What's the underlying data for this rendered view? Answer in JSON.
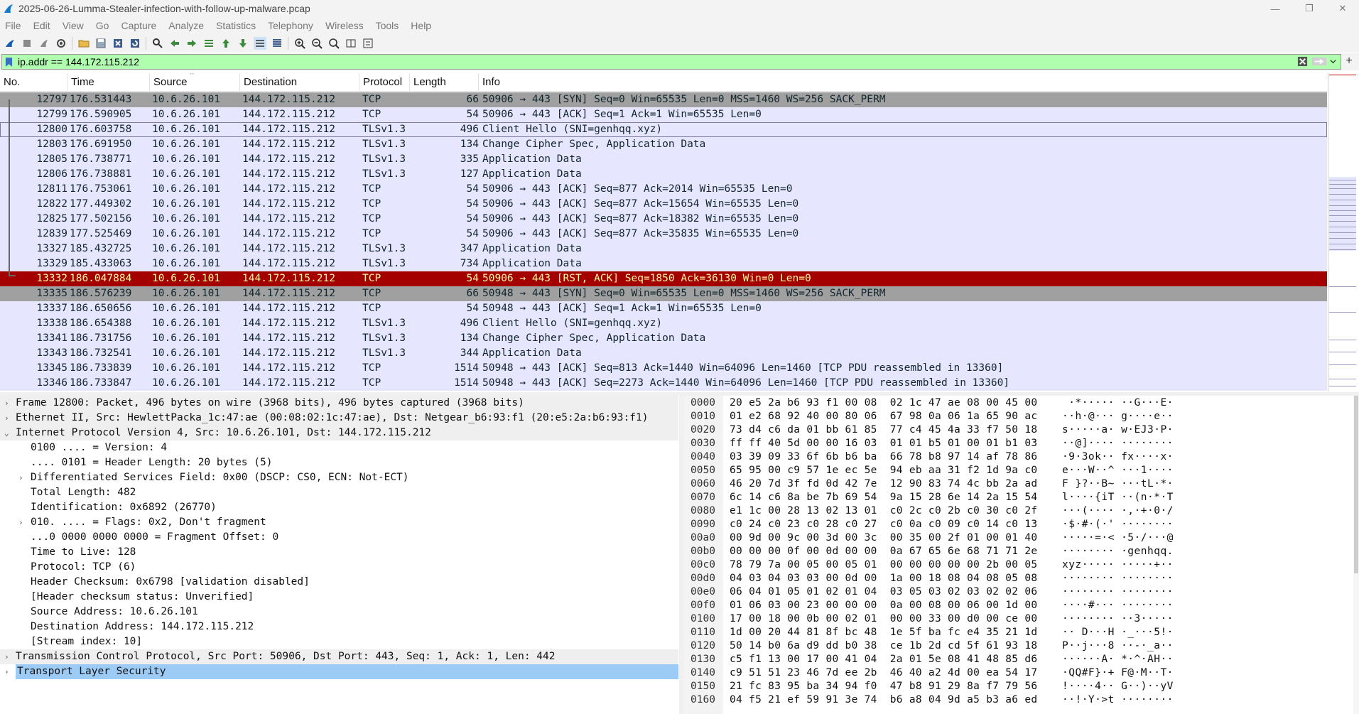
{
  "window": {
    "title": "2025-06-26-Lumma-Stealer-infection-with-follow-up-malware.pcap",
    "controls": [
      "—",
      "❐",
      "✕"
    ]
  },
  "menu": [
    "File",
    "Edit",
    "View",
    "Go",
    "Capture",
    "Analyze",
    "Statistics",
    "Telephony",
    "Wireless",
    "Tools",
    "Help"
  ],
  "filter": {
    "value": "ip.addr == 144.172.115.212",
    "add_label": "+"
  },
  "columns": {
    "no": "No.",
    "time": "Time",
    "source": "Source",
    "destination": "Destination",
    "protocol": "Protocol",
    "length": "Length",
    "info": "Info"
  },
  "packets": [
    {
      "no": "12797",
      "time": "176.531443",
      "src": "10.6.26.101",
      "dst": "144.172.115.212",
      "proto": "TCP",
      "len": "66",
      "info": "50906 → 443 [SYN] Seq=0 Win=65535 Len=0 MSS=1460 WS=256 SACK_PERM",
      "style": "gray"
    },
    {
      "no": "12799",
      "time": "176.590905",
      "src": "10.6.26.101",
      "dst": "144.172.115.212",
      "proto": "TCP",
      "len": "54",
      "info": "50906 → 443 [ACK] Seq=1 Ack=1 Win=65535 Len=0",
      "style": "lav"
    },
    {
      "no": "12800",
      "time": "176.603758",
      "src": "10.6.26.101",
      "dst": "144.172.115.212",
      "proto": "TLSv1.3",
      "len": "496",
      "info": "Client Hello (SNI=genhqq.xyz)",
      "style": "lav sel"
    },
    {
      "no": "12803",
      "time": "176.691950",
      "src": "10.6.26.101",
      "dst": "144.172.115.212",
      "proto": "TLSv1.3",
      "len": "134",
      "info": "Change Cipher Spec, Application Data",
      "style": "lav"
    },
    {
      "no": "12805",
      "time": "176.738771",
      "src": "10.6.26.101",
      "dst": "144.172.115.212",
      "proto": "TLSv1.3",
      "len": "335",
      "info": "Application Data",
      "style": "lav"
    },
    {
      "no": "12806",
      "time": "176.738881",
      "src": "10.6.26.101",
      "dst": "144.172.115.212",
      "proto": "TLSv1.3",
      "len": "127",
      "info": "Application Data",
      "style": "lav"
    },
    {
      "no": "12811",
      "time": "176.753061",
      "src": "10.6.26.101",
      "dst": "144.172.115.212",
      "proto": "TCP",
      "len": "54",
      "info": "50906 → 443 [ACK] Seq=877 Ack=2014 Win=65535 Len=0",
      "style": "lav"
    },
    {
      "no": "12822",
      "time": "177.449302",
      "src": "10.6.26.101",
      "dst": "144.172.115.212",
      "proto": "TCP",
      "len": "54",
      "info": "50906 → 443 [ACK] Seq=877 Ack=15654 Win=65535 Len=0",
      "style": "lav"
    },
    {
      "no": "12825",
      "time": "177.502156",
      "src": "10.6.26.101",
      "dst": "144.172.115.212",
      "proto": "TCP",
      "len": "54",
      "info": "50906 → 443 [ACK] Seq=877 Ack=18382 Win=65535 Len=0",
      "style": "lav"
    },
    {
      "no": "12839",
      "time": "177.525469",
      "src": "10.6.26.101",
      "dst": "144.172.115.212",
      "proto": "TCP",
      "len": "54",
      "info": "50906 → 443 [ACK] Seq=877 Ack=35835 Win=65535 Len=0",
      "style": "lav"
    },
    {
      "no": "13327",
      "time": "185.432725",
      "src": "10.6.26.101",
      "dst": "144.172.115.212",
      "proto": "TLSv1.3",
      "len": "347",
      "info": "Application Data",
      "style": "lav"
    },
    {
      "no": "13329",
      "time": "185.433063",
      "src": "10.6.26.101",
      "dst": "144.172.115.212",
      "proto": "TLSv1.3",
      "len": "734",
      "info": "Application Data",
      "style": "lav"
    },
    {
      "no": "13332",
      "time": "186.047884",
      "src": "10.6.26.101",
      "dst": "144.172.115.212",
      "proto": "TCP",
      "len": "54",
      "info": "50906 → 443 [RST, ACK] Seq=1850 Ack=36130 Win=0 Len=0",
      "style": "red"
    },
    {
      "no": "13335",
      "time": "186.576239",
      "src": "10.6.26.101",
      "dst": "144.172.115.212",
      "proto": "TCP",
      "len": "66",
      "info": "50948 → 443 [SYN] Seq=0 Win=65535 Len=0 MSS=1460 WS=256 SACK_PERM",
      "style": "gray"
    },
    {
      "no": "13337",
      "time": "186.650656",
      "src": "10.6.26.101",
      "dst": "144.172.115.212",
      "proto": "TCP",
      "len": "54",
      "info": "50948 → 443 [ACK] Seq=1 Ack=1 Win=65535 Len=0",
      "style": "lav"
    },
    {
      "no": "13338",
      "time": "186.654388",
      "src": "10.6.26.101",
      "dst": "144.172.115.212",
      "proto": "TLSv1.3",
      "len": "496",
      "info": "Client Hello (SNI=genhqq.xyz)",
      "style": "lav"
    },
    {
      "no": "13341",
      "time": "186.731756",
      "src": "10.6.26.101",
      "dst": "144.172.115.212",
      "proto": "TLSv1.3",
      "len": "134",
      "info": "Change Cipher Spec, Application Data",
      "style": "lav"
    },
    {
      "no": "13343",
      "time": "186.732541",
      "src": "10.6.26.101",
      "dst": "144.172.115.212",
      "proto": "TLSv1.3",
      "len": "344",
      "info": "Application Data",
      "style": "lav"
    },
    {
      "no": "13345",
      "time": "186.733839",
      "src": "10.6.26.101",
      "dst": "144.172.115.212",
      "proto": "TCP",
      "len": "1514",
      "info": "50948 → 443 [ACK] Seq=813 Ack=1440 Win=64096 Len=1460 [TCP PDU reassembled in 13360]",
      "style": "lav"
    },
    {
      "no": "13346",
      "time": "186.733847",
      "src": "10.6.26.101",
      "dst": "144.172.115.212",
      "proto": "TCP",
      "len": "1514",
      "info": "50948 → 443 [ACK] Seq=2273 Ack=1440 Win=64096 Len=1460 [TCP PDU reassembled in 13360]",
      "style": "lav"
    }
  ],
  "details": [
    {
      "text": "Frame 12800: Packet, 496 bytes on wire (3968 bits), 496 bytes captured (3968 bits)",
      "level": 0,
      "arrow": "›",
      "top": true
    },
    {
      "text": "Ethernet II, Src: HewlettPacka_1c:47:ae (00:08:02:1c:47:ae), Dst: Netgear_b6:93:f1 (20:e5:2a:b6:93:f1)",
      "level": 0,
      "arrow": "›",
      "top": true
    },
    {
      "text": "Internet Protocol Version 4, Src: 10.6.26.101, Dst: 144.172.115.212",
      "level": 0,
      "arrow": "⌄",
      "top": true
    },
    {
      "text": "0100 .... = Version: 4",
      "level": 1,
      "arrow": ""
    },
    {
      "text": ".... 0101 = Header Length: 20 bytes (5)",
      "level": 1,
      "arrow": ""
    },
    {
      "text": "Differentiated Services Field: 0x00 (DSCP: CS0, ECN: Not-ECT)",
      "level": 1,
      "arrow": "›"
    },
    {
      "text": "Total Length: 482",
      "level": 1,
      "arrow": ""
    },
    {
      "text": "Identification: 0x6892 (26770)",
      "level": 1,
      "arrow": ""
    },
    {
      "text": "010. .... = Flags: 0x2, Don't fragment",
      "level": 1,
      "arrow": "›"
    },
    {
      "text": "...0 0000 0000 0000 = Fragment Offset: 0",
      "level": 1,
      "arrow": ""
    },
    {
      "text": "Time to Live: 128",
      "level": 1,
      "arrow": ""
    },
    {
      "text": "Protocol: TCP (6)",
      "level": 1,
      "arrow": ""
    },
    {
      "text": "Header Checksum: 0x6798 [validation disabled]",
      "level": 1,
      "arrow": ""
    },
    {
      "text": "[Header checksum status: Unverified]",
      "level": 1,
      "arrow": ""
    },
    {
      "text": "Source Address: 10.6.26.101",
      "level": 1,
      "arrow": ""
    },
    {
      "text": "Destination Address: 144.172.115.212",
      "level": 1,
      "arrow": ""
    },
    {
      "text": "[Stream index: 10]",
      "level": 1,
      "arrow": ""
    },
    {
      "text": "Transmission Control Protocol, Src Port: 50906, Dst Port: 443, Seq: 1, Ack: 1, Len: 442",
      "level": 0,
      "arrow": "›",
      "top": true
    },
    {
      "text": "Transport Layer Security",
      "level": 0,
      "arrow": "›",
      "top": true,
      "selected": true
    }
  ],
  "hex": [
    {
      "off": "0000",
      "bytes": "20 e5 2a b6 93 f1 00 08  02 1c 47 ae 08 00 45 00",
      "ascii": " ·*····· ··G···E·"
    },
    {
      "off": "0010",
      "bytes": "01 e2 68 92 40 00 80 06  67 98 0a 06 1a 65 90 ac",
      "ascii": "··h·@··· g····e··"
    },
    {
      "off": "0020",
      "bytes": "73 d4 c6 da 01 bb 61 85  77 c4 45 4a 33 f7 50 18",
      "ascii": "s·····a· w·EJ3·P·"
    },
    {
      "off": "0030",
      "bytes": "ff ff 40 5d 00 00 16 03  01 01 b5 01 00 01 b1 03",
      "ascii": "··@]···· ········"
    },
    {
      "off": "0040",
      "bytes": "03 39 09 33 6f 6b b6 ba  66 78 b8 97 14 af 78 86",
      "ascii": "·9·3ok·· fx····x·"
    },
    {
      "off": "0050",
      "bytes": "65 95 00 c9 57 1e ec 5e  94 eb aa 31 f2 1d 9a c0",
      "ascii": "e···W··^ ···1····"
    },
    {
      "off": "0060",
      "bytes": "46 20 7d 3f fd 0d 42 7e  12 90 83 74 4c bb 2a ad",
      "ascii": "F }?··B~ ···tL·*·"
    },
    {
      "off": "0070",
      "bytes": "6c 14 c6 8a be 7b 69 54  9a 15 28 6e 14 2a 15 54",
      "ascii": "l····{iT ··(n·*·T"
    },
    {
      "off": "0080",
      "bytes": "e1 1c 00 28 13 02 13 01  c0 2c c0 2b c0 30 c0 2f",
      "ascii": "···(···· ·,·+·0·/"
    },
    {
      "off": "0090",
      "bytes": "c0 24 c0 23 c0 28 c0 27  c0 0a c0 09 c0 14 c0 13",
      "ascii": "·$·#·(·' ········"
    },
    {
      "off": "00a0",
      "bytes": "00 9d 00 9c 00 3d 00 3c  00 35 00 2f 01 00 01 40",
      "ascii": "·····=·< ·5·/···@"
    },
    {
      "off": "00b0",
      "bytes": "00 00 00 0f 00 0d 00 00  0a 67 65 6e 68 71 71 2e",
      "ascii": "········ ·genhqq."
    },
    {
      "off": "00c0",
      "bytes": "78 79 7a 00 05 00 05 01  00 00 00 00 00 2b 00 05",
      "ascii": "xyz····· ·····+··"
    },
    {
      "off": "00d0",
      "bytes": "04 03 04 03 03 00 0d 00  1a 00 18 08 04 08 05 08",
      "ascii": "········ ········"
    },
    {
      "off": "00e0",
      "bytes": "06 04 01 05 01 02 01 04  03 05 03 02 03 02 02 06",
      "ascii": "········ ········"
    },
    {
      "off": "00f0",
      "bytes": "01 06 03 00 23 00 00 00  0a 00 08 00 06 00 1d 00",
      "ascii": "····#··· ········"
    },
    {
      "off": "0100",
      "bytes": "17 00 18 00 0b 00 02 01  00 00 33 00 d0 00 ce 00",
      "ascii": "········ ··3·····"
    },
    {
      "off": "0110",
      "bytes": "1d 00 20 44 81 8f bc 48  1e 5f ba fc e4 35 21 1d",
      "ascii": "·· D···H ·_···5!·"
    },
    {
      "off": "0120",
      "bytes": "50 14 b0 6a d9 dd b0 38  ce 1b 2d cd 5f 61 93 18",
      "ascii": "P··j···8 ··-·_a··"
    },
    {
      "off": "0130",
      "bytes": "c5 f1 13 00 17 00 41 04  2a 01 5e 08 41 48 85 d6",
      "ascii": "······A· *·^·AH··"
    },
    {
      "off": "0140",
      "bytes": "c9 51 51 23 46 7d ee 2b  46 40 a2 4d 00 ea 54 17",
      "ascii": "·QQ#F}·+ F@·M··T·"
    },
    {
      "off": "0150",
      "bytes": "21 fc 83 95 ba 34 94 f0  47 b8 91 29 8a f7 79 56",
      "ascii": "!····4·· G··)··yV"
    },
    {
      "off": "0160",
      "bytes": "04 f5 21 ef 59 91 3e 74  b6 a8 04 9d a5 b3 a6 ed",
      "ascii": "··!·Y·>t ········"
    }
  ],
  "colors": {
    "filter_bg": "#afffaf",
    "row_gray": "#a0a0a0",
    "row_lavender": "#e7e6ff",
    "row_red": "#a40000",
    "row_red_text": "#fffc9c",
    "tree_selected": "#9ccbf5"
  }
}
